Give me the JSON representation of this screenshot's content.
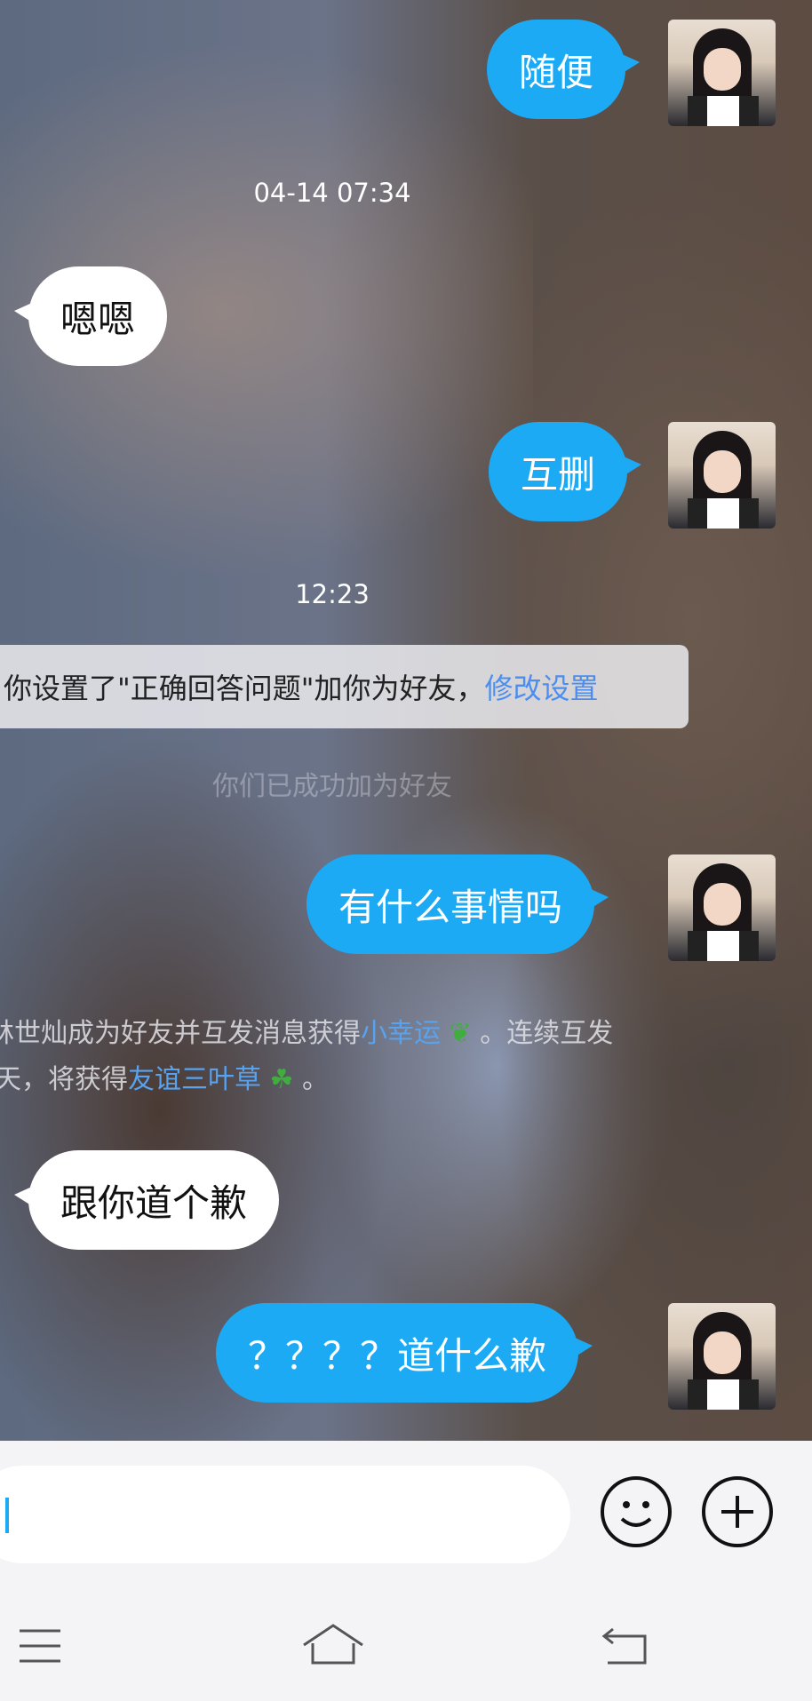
{
  "messages": [
    {
      "side": "me",
      "text": "随便"
    },
    {
      "timestamp": "04-14 07:34"
    },
    {
      "side": "them",
      "text": "嗯嗯"
    },
    {
      "side": "me",
      "text": "互删"
    },
    {
      "timestamp": "12:23"
    },
    {
      "system": {
        "text": "你设置了\"正确回答问题\"加你为好友，",
        "link": "修改设置"
      }
    },
    {
      "faint": "你们已成功加为好友"
    },
    {
      "side": "me",
      "text": "有什么事情吗"
    },
    {
      "lucky": {
        "line1_prefix": "林世灿成为好友并互发消息获得",
        "line1_link": "小幸运",
        "line1_suffix": "。连续互发",
        "line2_prefix": "天，将获得",
        "line2_link": "友谊三叶草",
        "line2_suffix": "。"
      }
    },
    {
      "side": "them",
      "text": "跟你道个歉"
    },
    {
      "side": "me",
      "text": "？？？？道什么歉"
    }
  ],
  "input": {
    "value": ""
  },
  "colors": {
    "my_bubble": "#1daaf5",
    "their_bubble": "#ffffff",
    "link": "#4b8ef0"
  }
}
